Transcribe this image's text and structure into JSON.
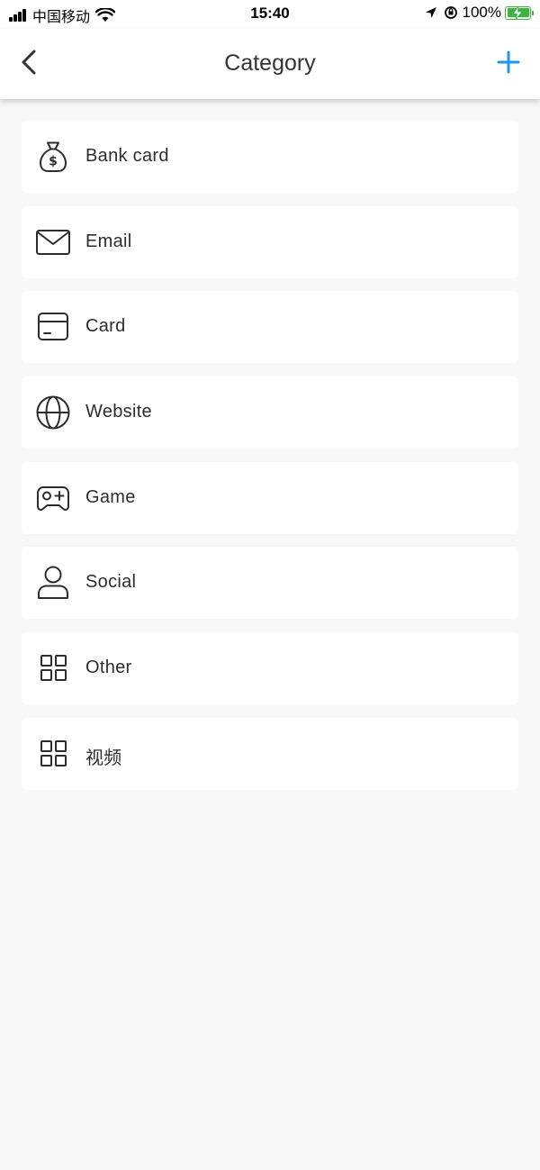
{
  "status_bar": {
    "carrier": "中国移动",
    "time": "15:40",
    "battery": "100%"
  },
  "nav": {
    "title": "Category"
  },
  "colors": {
    "accent": "#2196f3",
    "background": "#f8f8f8",
    "card": "#ffffff",
    "battery": "#3fb33f"
  },
  "categories": [
    {
      "label": "Bank card",
      "icon": "money-bag-icon"
    },
    {
      "label": "Email",
      "icon": "envelope-icon"
    },
    {
      "label": "Card",
      "icon": "card-icon"
    },
    {
      "label": "Website",
      "icon": "globe-icon"
    },
    {
      "label": "Game",
      "icon": "gamepad-icon"
    },
    {
      "label": "Social",
      "icon": "person-icon"
    },
    {
      "label": "Other",
      "icon": "grid-icon"
    },
    {
      "label": "视频",
      "icon": "grid-icon"
    }
  ]
}
